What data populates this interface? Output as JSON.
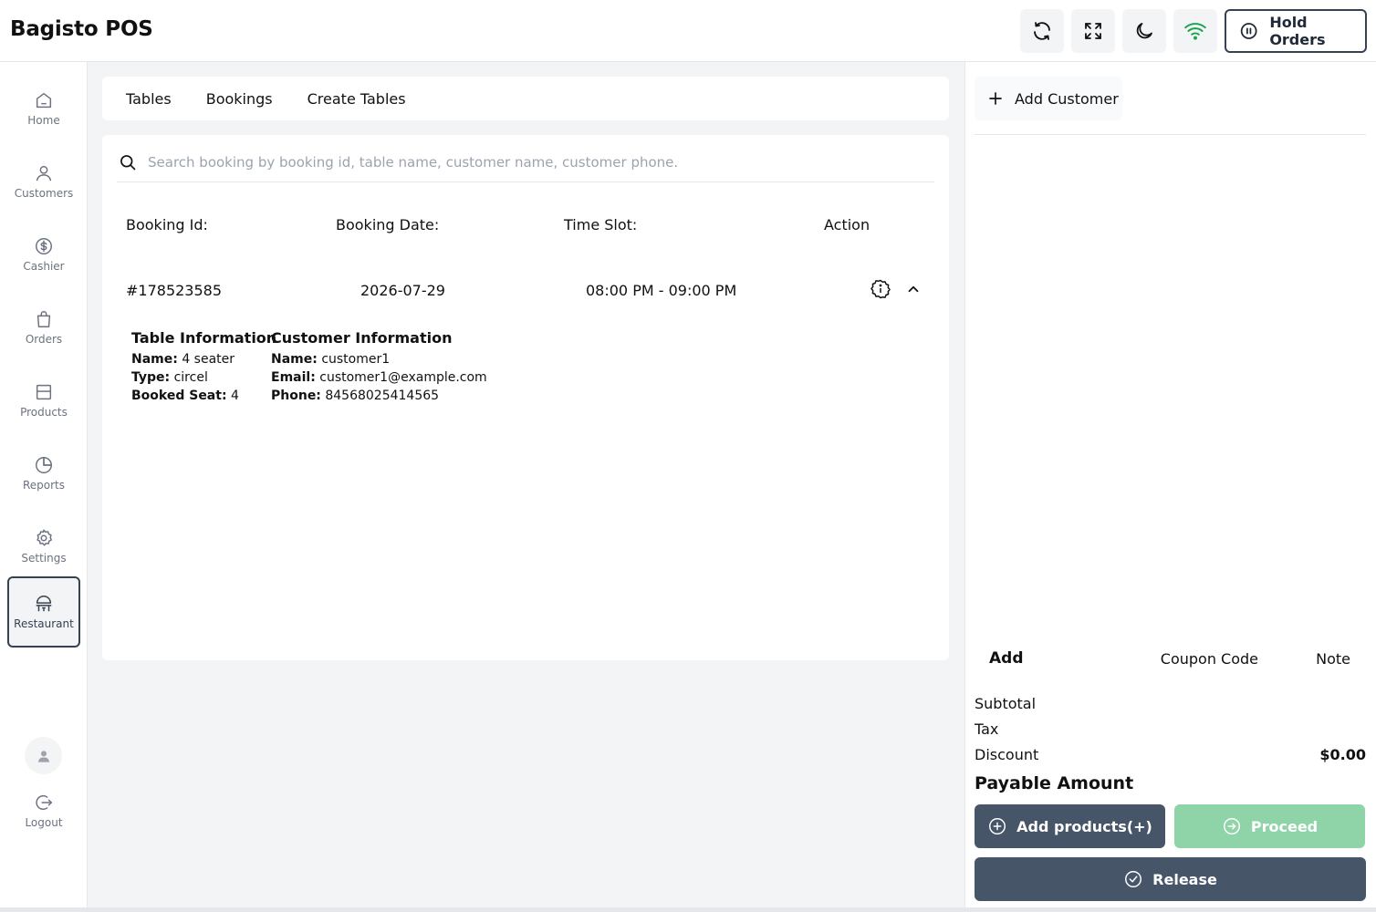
{
  "app": {
    "title": "Bagisto POS"
  },
  "header": {
    "icons": [
      "refresh-icon",
      "fullscreen-icon",
      "dark-mode-icon",
      "wifi-icon"
    ],
    "hold_orders_label": "Hold Orders",
    "wifi_color": "#16a34a"
  },
  "sidebar": {
    "items": [
      {
        "label": "Home",
        "icon": "home-icon"
      },
      {
        "label": "Customers",
        "icon": "user-icon"
      },
      {
        "label": "Cashier",
        "icon": "dollar-icon"
      },
      {
        "label": "Orders",
        "icon": "shopping-bag-icon"
      },
      {
        "label": "Products",
        "icon": "box-icon"
      },
      {
        "label": "Reports",
        "icon": "pie-chart-icon"
      },
      {
        "label": "Settings",
        "icon": "gear-icon"
      },
      {
        "label": "Restaurant",
        "icon": "restaurant-icon",
        "active": true
      }
    ],
    "logout_label": "Logout"
  },
  "main": {
    "tabs": [
      {
        "label": "Tables"
      },
      {
        "label": "Bookings"
      },
      {
        "label": "Create Tables"
      }
    ],
    "search": {
      "placeholder": "Search booking by booking id, table name, customer name, customer phone.",
      "value": ""
    },
    "columns": [
      "Booking Id:",
      "Booking Date:",
      "Time Slot:",
      "Action"
    ],
    "booking": {
      "id": "#178523585",
      "date": "2026-07-29",
      "time_slot": "08:00 PM - 09:00 PM",
      "table_info": {
        "title": "Table Information",
        "name_label": "Name:",
        "name": "4 seater",
        "type_label": "Type:",
        "type": "circel",
        "seat_label": "Booked Seat:",
        "seat": "4"
      },
      "customer_info": {
        "title": "Customer Information",
        "name_label": "Name:",
        "name": "customer1",
        "email_label": "Email:",
        "email": "customer1@example.com",
        "phone_label": "Phone:",
        "phone": "84568025414565"
      }
    }
  },
  "cart": {
    "add_customer_label": "Add Customer",
    "add_label": "Add",
    "coupon_label": "Coupon Code",
    "note_label": "Note",
    "subtotal_label": "Subtotal",
    "tax_label": "Tax",
    "discount_label": "Discount",
    "discount_value": "$0.00",
    "payable_label": "Payable Amount",
    "add_products_label": "Add products(+)",
    "proceed_label": "Proceed",
    "release_label": "Release",
    "colors": {
      "dark_button": "#475569",
      "proceed_button": "#8fd4a8"
    }
  }
}
